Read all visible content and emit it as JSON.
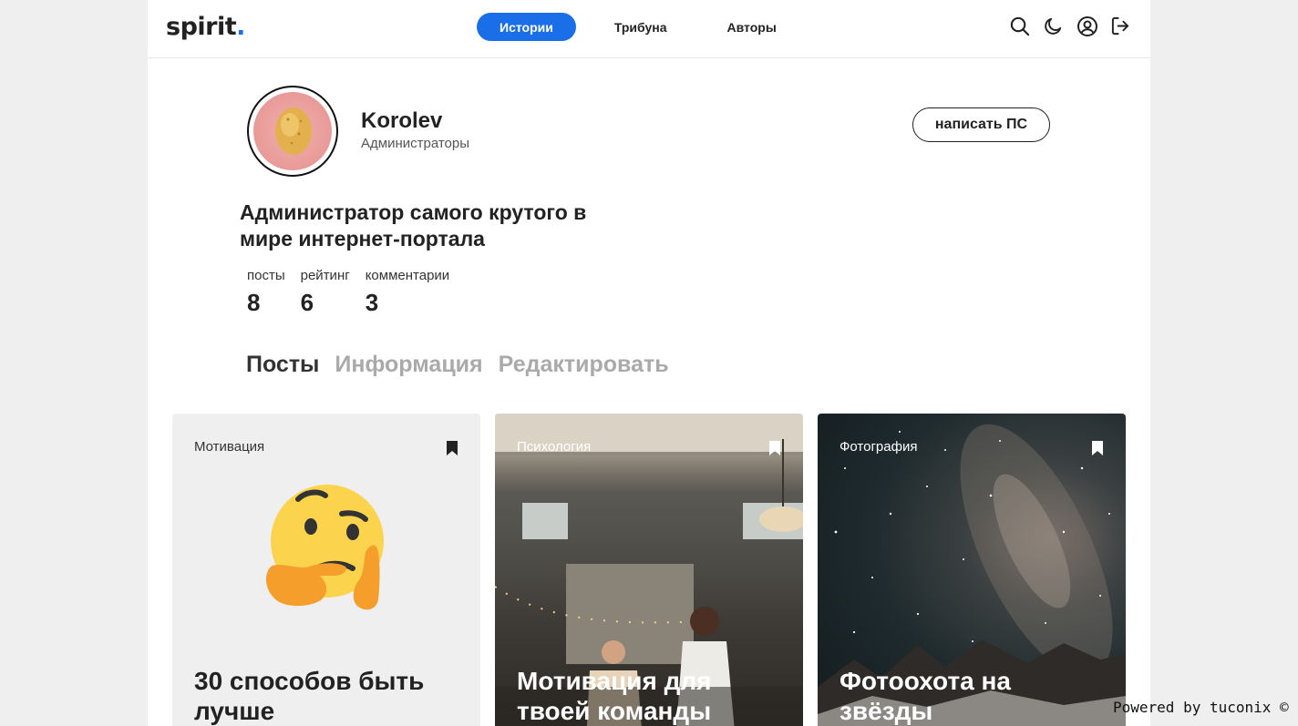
{
  "brand": {
    "logo_text": "spirit",
    "logo_dot": ".",
    "accent_color": "#1a6ee8"
  },
  "nav": {
    "items": [
      {
        "label": "Истории",
        "active": true
      },
      {
        "label": "Трибуна",
        "active": false
      },
      {
        "label": "Авторы",
        "active": false
      }
    ]
  },
  "header_icons": [
    "search-icon",
    "moon-icon",
    "user-circle-icon",
    "logout-icon"
  ],
  "profile": {
    "name": "Korolev",
    "group": "Администраторы",
    "pm_button": "написать ПС",
    "bio": "Администратор самого крутого в мире интернет-портала",
    "stats": [
      {
        "label": "посты",
        "value": "8"
      },
      {
        "label": "рейтинг",
        "value": "6"
      },
      {
        "label": "комментарии",
        "value": "3"
      }
    ]
  },
  "tabs": [
    {
      "label": "Посты",
      "active": true
    },
    {
      "label": "Информация",
      "active": false
    },
    {
      "label": "Редактировать",
      "active": false
    }
  ],
  "cards": [
    {
      "category": "Мотивация",
      "title": "30 способов быть лучше",
      "image": "thinking-face-emoji"
    },
    {
      "category": "Психология",
      "title": "Мотивация для твоей команды",
      "image": "office-photo"
    },
    {
      "category": "Фотография",
      "title": "Фотоохота на звёзды",
      "image": "milky-way-photo"
    }
  ],
  "footer": {
    "powered": "Powered by tuconix ©"
  }
}
